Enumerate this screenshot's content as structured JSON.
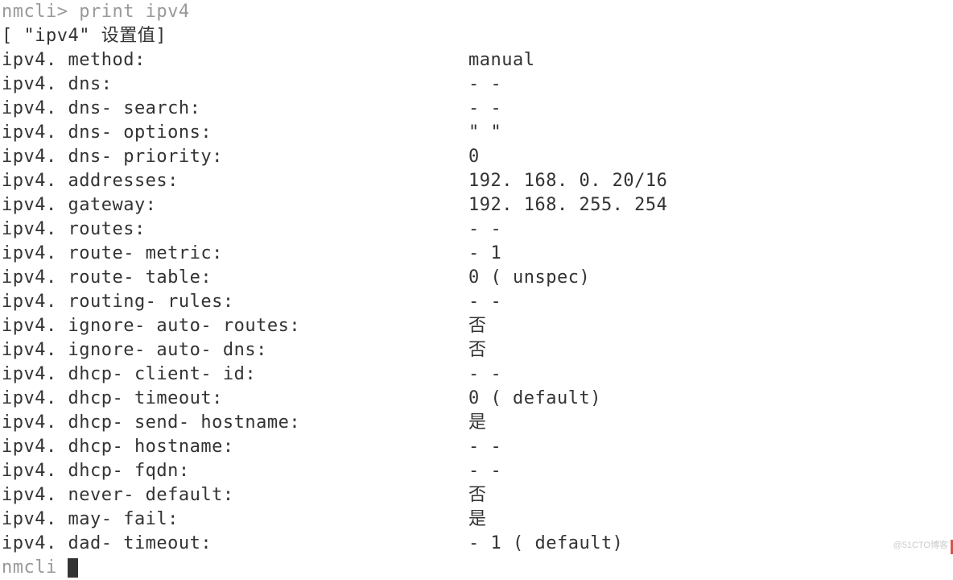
{
  "prompt_line": "nmcli> print ipv4",
  "header_line": "[ \"ipv4\" 设置值]",
  "properties": [
    {
      "key": "ipv4. method:",
      "value": "manual"
    },
    {
      "key": "ipv4. dns:",
      "value": "- -"
    },
    {
      "key": "ipv4. dns- search:",
      "value": "- -"
    },
    {
      "key": "ipv4. dns- options:",
      "value": "\" \""
    },
    {
      "key": "ipv4. dns- priority:",
      "value": "0"
    },
    {
      "key": "ipv4. addresses:",
      "value": "192. 168. 0. 20/16"
    },
    {
      "key": "ipv4. gateway:",
      "value": "192. 168. 255. 254"
    },
    {
      "key": "ipv4. routes:",
      "value": "- -"
    },
    {
      "key": "ipv4. route- metric:",
      "value": "- 1"
    },
    {
      "key": "ipv4. route- table:",
      "value": "0 ( unspec)"
    },
    {
      "key": "ipv4. routing- rules:",
      "value": "- -"
    },
    {
      "key": "ipv4. ignore- auto- routes:",
      "value": "否"
    },
    {
      "key": "ipv4. ignore- auto- dns:",
      "value": "否"
    },
    {
      "key": "ipv4. dhcp- client- id:",
      "value": "- -"
    },
    {
      "key": "ipv4. dhcp- timeout:",
      "value": "0 ( default)"
    },
    {
      "key": "ipv4. dhcp- send- hostname:",
      "value": "是"
    },
    {
      "key": "ipv4. dhcp- hostname:",
      "value": "- -"
    },
    {
      "key": "ipv4. dhcp- fqdn:",
      "value": "- -"
    },
    {
      "key": "ipv4. never- default:",
      "value": "否"
    },
    {
      "key": "ipv4. may- fail:",
      "value": "是"
    },
    {
      "key": "ipv4. dad- timeout:",
      "value": "- 1 ( default)"
    }
  ],
  "next_prompt_prefix": "nmcli ",
  "watermark": "@51CTO博客"
}
